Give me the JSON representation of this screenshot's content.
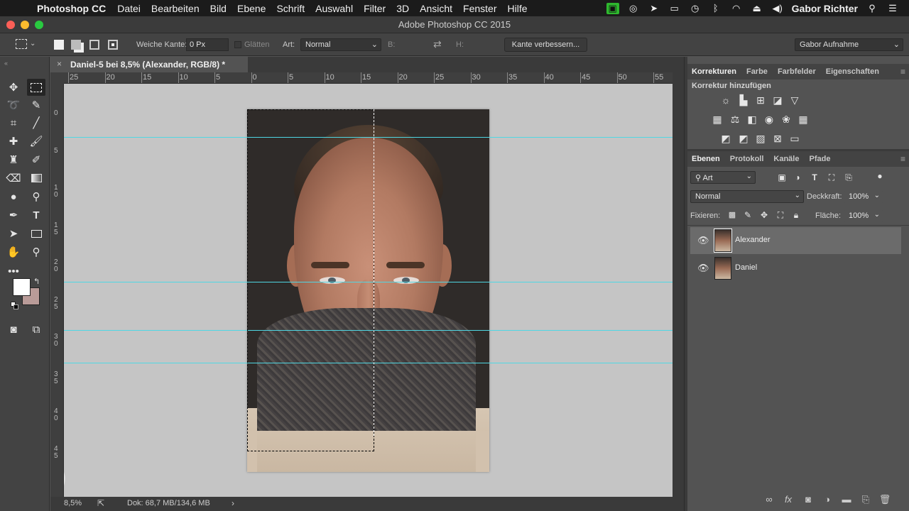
{
  "menubar": {
    "app_name": "Photoshop CC",
    "items": [
      "Datei",
      "Bearbeiten",
      "Bild",
      "Ebene",
      "Schrift",
      "Auswahl",
      "Filter",
      "3D",
      "Ansicht",
      "Fenster",
      "Hilfe"
    ],
    "user": "Gabor Richter"
  },
  "window": {
    "title": "Adobe Photoshop CC 2015"
  },
  "options": {
    "feather_label": "Weiche Kante:",
    "feather_value": "0 Px",
    "antialias_label": "Glätten",
    "style_label": "Art:",
    "style_value": "Normal",
    "width_label": "B:",
    "height_label": "H:",
    "refine_button": "Kante verbessern...",
    "workspace": "Gabor Aufnahme"
  },
  "document": {
    "tab_title": "Daniel-5 bei 8,5% (Alexander, RGB/8) *",
    "zoom": "8,5%",
    "doc_info": "Dok: 68,7 MB/134,6 MB"
  },
  "rulers": {
    "h_labels": [
      "25",
      "20",
      "15",
      "10",
      "5",
      "0",
      "5",
      "10",
      "15",
      "20",
      "25",
      "30",
      "35",
      "40",
      "45",
      "50",
      "55"
    ],
    "v_labels": [
      "0",
      "5",
      "1 0",
      "1 5",
      "2 0",
      "2 5",
      "3 0",
      "3 5",
      "4 0",
      "4 5"
    ]
  },
  "panels": {
    "adjust_tabs": [
      "Korrekturen",
      "Farbe",
      "Farbfelder",
      "Eigenschaften"
    ],
    "adjust_heading": "Korrektur hinzufügen",
    "layer_tabs": [
      "Ebenen",
      "Protokoll",
      "Kanäle",
      "Pfade"
    ],
    "filter_kind": "Art",
    "blend_mode": "Normal",
    "opacity_label": "Deckkraft:",
    "opacity_value": "100%",
    "lock_label": "Fixieren:",
    "fill_label": "Fläche:",
    "fill_value": "100%",
    "layers": [
      {
        "name": "Alexander",
        "selected": true
      },
      {
        "name": "Daniel",
        "selected": false
      }
    ]
  },
  "colors": {
    "foreground": "#ffffff",
    "background": "#b99b98",
    "guide": "#4fd7e3"
  }
}
